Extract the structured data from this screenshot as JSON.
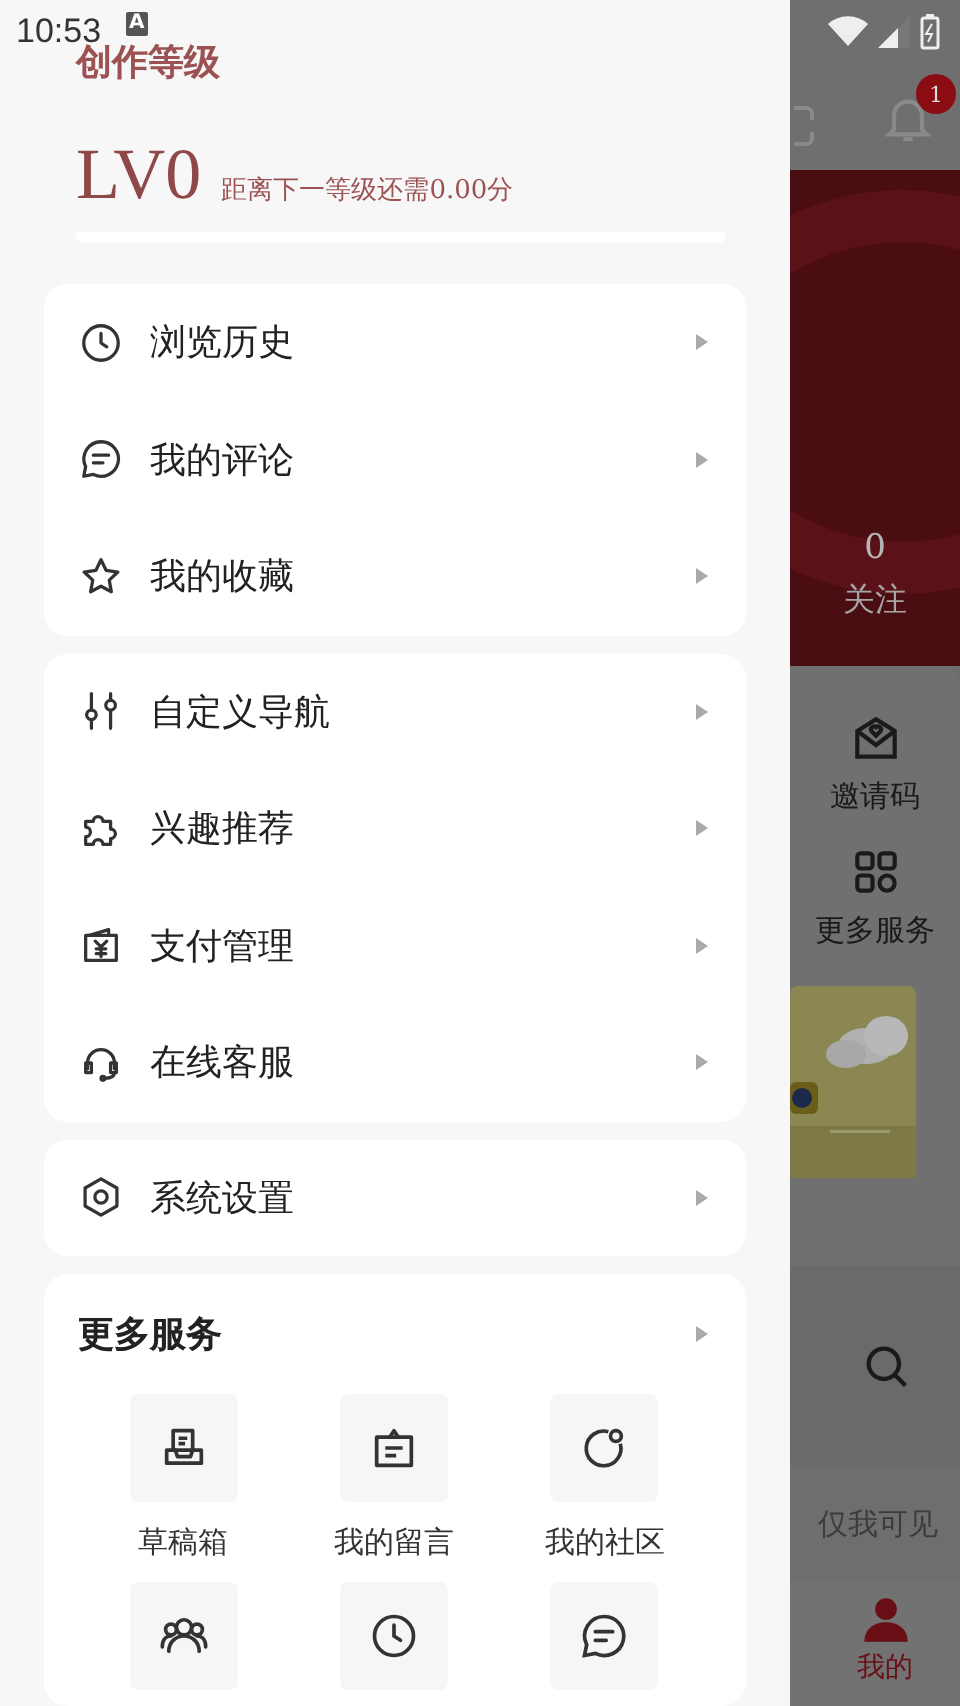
{
  "status_bar": {
    "time": "10:53",
    "notification": "A"
  },
  "drawer": {
    "level_title": "创作等级",
    "level_name": "LV0",
    "level_hint": "距离下一等级还需0.00分",
    "menu_groups": [
      {
        "items": [
          {
            "label": "浏览历史"
          },
          {
            "label": "我的评论"
          },
          {
            "label": "我的收藏"
          }
        ]
      },
      {
        "items": [
          {
            "label": "自定义导航"
          },
          {
            "label": "兴趣推荐"
          },
          {
            "label": "支付管理"
          },
          {
            "label": "在线客服"
          }
        ]
      },
      {
        "items": [
          {
            "label": "系统设置"
          }
        ]
      }
    ],
    "more_services": {
      "title": "更多服务",
      "items": [
        {
          "label": "草稿箱"
        },
        {
          "label": "我的留言"
        },
        {
          "label": "我的社区"
        }
      ]
    }
  },
  "background": {
    "notification_badge": "1",
    "following_count": "0",
    "following_label": "关注",
    "shortcuts": [
      {
        "label": "邀请码"
      },
      {
        "label": "更多服务"
      }
    ],
    "visibility": "仅我可见",
    "active_tab": "我的"
  }
}
